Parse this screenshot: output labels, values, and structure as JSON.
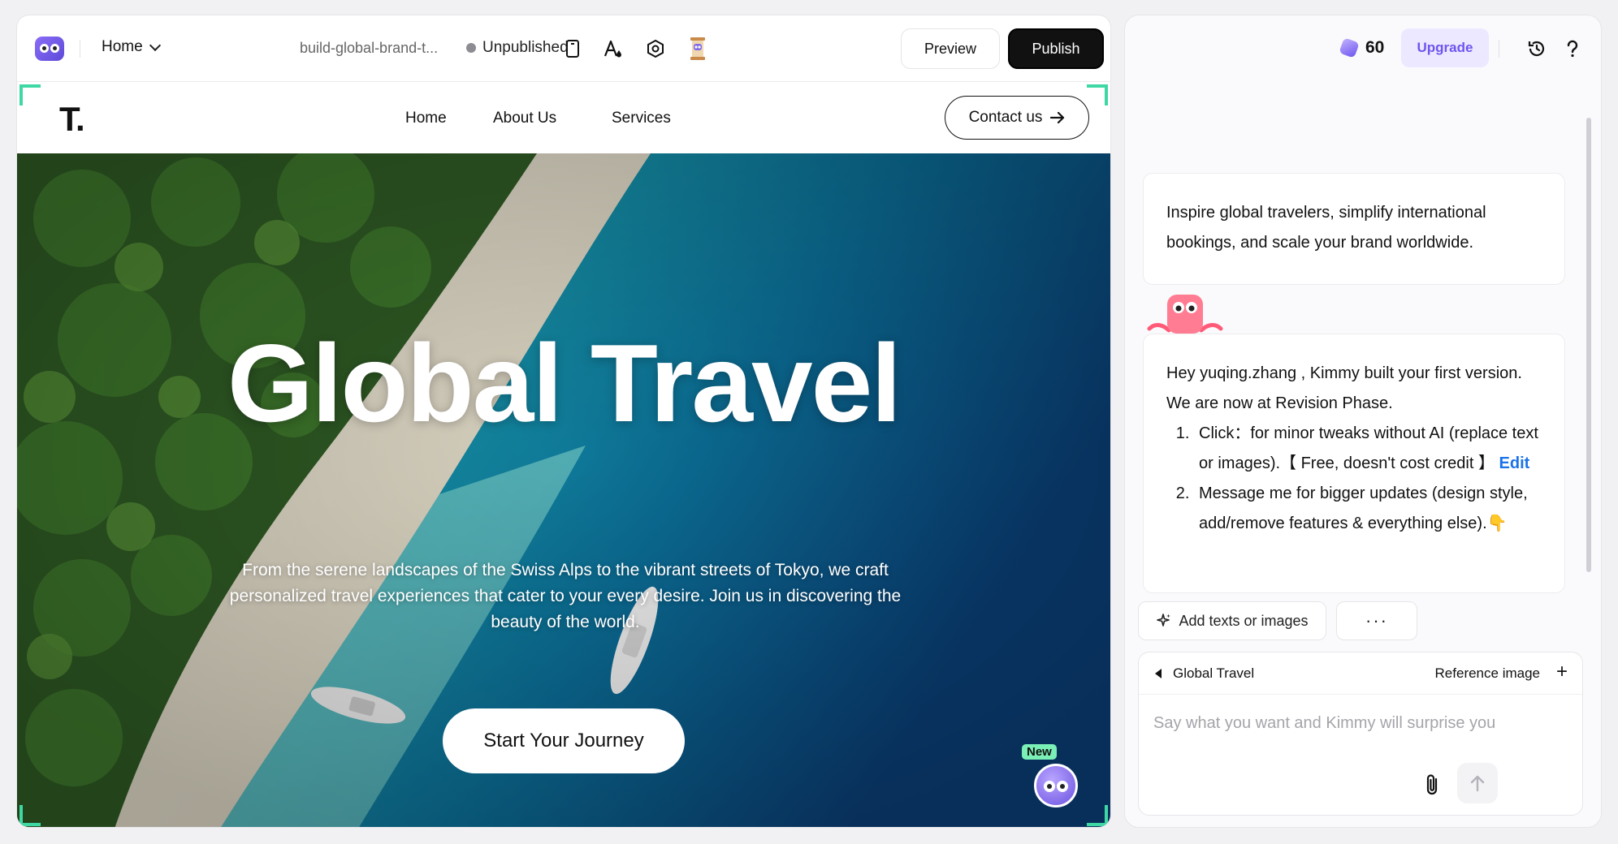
{
  "editor": {
    "page_selector": "Home",
    "project_name": "build-global-brand-t...",
    "status": "Unpublished",
    "preview_label": "Preview",
    "publish_label": "Publish",
    "icons": [
      "mobile-view-icon",
      "text-style-icon",
      "settings-icon",
      "hourglass-icon"
    ]
  },
  "site": {
    "logo": "T.",
    "nav": [
      "Home",
      "About Us",
      "Services"
    ],
    "contact_label": "Contact us",
    "hero_title": "Global Travel",
    "hero_text": "From the serene landscapes of the Swiss Alps to the vibrant streets of Tokyo, we craft personalized travel experiences that cater to your every desire. Join us in discovering the beauty of the world.",
    "hero_button": "Start Your Journey",
    "new_badge": "New"
  },
  "chat": {
    "credits": "60",
    "upgrade_label": "Upgrade",
    "msg1": "Inspire global travelers, simplify international bookings, and scale your brand worldwide.",
    "msg2_intro": "Hey yuqing.zhang , Kimmy built your first version. We are now at Revision Phase.",
    "msg2_item1": "Click：for minor tweaks without AI (replace text or images).【 Free, doesn't cost credit 】",
    "msg2_item1_link": "Edit",
    "msg2_item2": "Message me for bigger updates (design style, add/remove features & everything else).👇",
    "chip_add": "Add texts or images",
    "chip_more": "···",
    "context_name": "Global Travel",
    "reference_label": "Reference image",
    "input_placeholder": "Say what you want and Kimmy will surprise you"
  },
  "colors": {
    "accent_green": "#3fd8a5",
    "brand_purple": "#6e55ef",
    "link_blue": "#1a73e8"
  }
}
